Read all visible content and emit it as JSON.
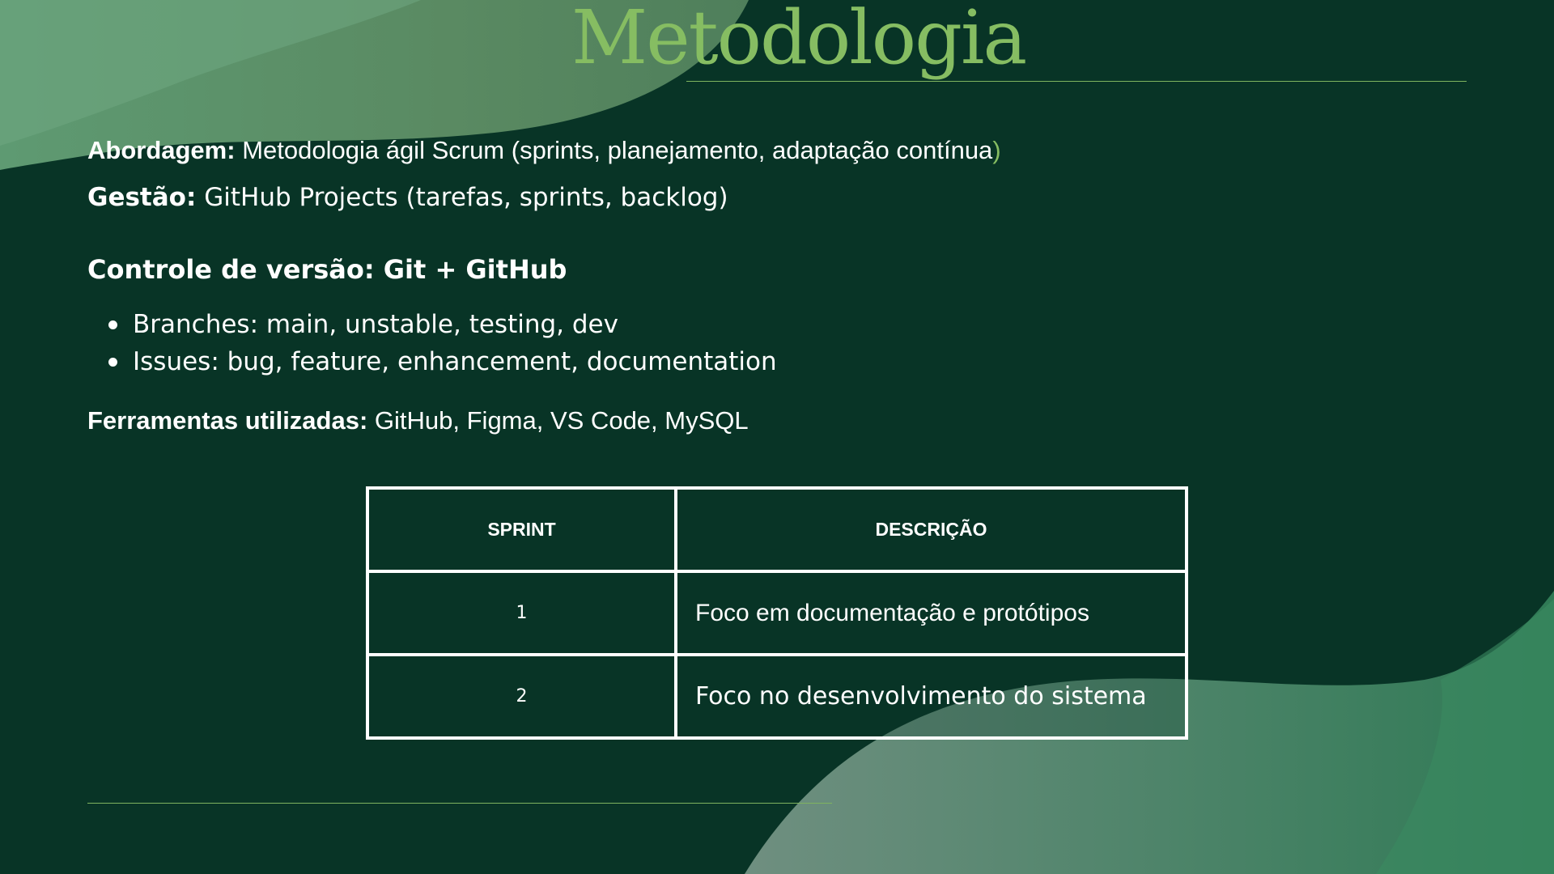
{
  "slide": {
    "title": "Metodologia",
    "colors": {
      "background": "#083426",
      "accent": "#86bd62",
      "wave": "#5e9a72",
      "text": "#ffffff"
    }
  },
  "content": {
    "abordagem": {
      "label": "Abordagem:",
      "text": " Metodologia ágil Scrum (sprints, planejamento, adaptação contínua",
      "closing": ")"
    },
    "gestao": {
      "label": "Gestão:",
      "text": " GitHub Projects (tarefas, sprints, backlog)"
    },
    "version_control": {
      "heading": "Controle de versão: Git + GitHub",
      "bullets": [
        "Branches: main, unstable, testing, dev",
        "Issues: bug, feature, enhancement, documentation"
      ]
    },
    "ferramentas": {
      "label": "Ferramentas utilizadas:",
      "text": " GitHub, Figma, VS Code, MySQL"
    }
  },
  "table": {
    "headers": [
      "SPRINT",
      "DESCRIÇÃO"
    ],
    "rows": [
      {
        "sprint": "1",
        "descricao": "Foco em documentação e protótipos"
      },
      {
        "sprint": "2",
        "descricao": "Foco no desenvolvimento do sistema"
      }
    ]
  }
}
